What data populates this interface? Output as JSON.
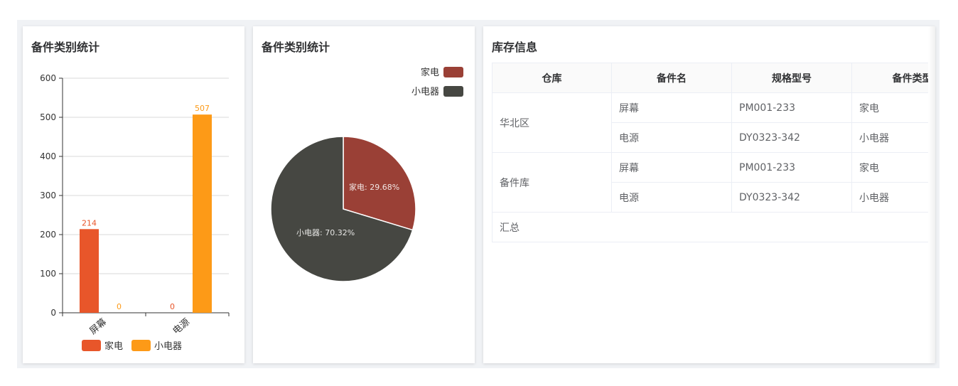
{
  "bar_card": {
    "title": "备件类别统计"
  },
  "pie_card": {
    "title": "备件类别统计"
  },
  "table_card": {
    "title": "库存信息",
    "headers": [
      "仓库",
      "备件名",
      "规格型号",
      "备件类型"
    ],
    "groups": [
      {
        "warehouse": "华北区",
        "rows": [
          {
            "name": "屏幕",
            "model": "PM001-233",
            "type": "家电"
          },
          {
            "name": "电源",
            "model": "DY0323-342",
            "type": "小电器"
          }
        ]
      },
      {
        "warehouse": "备件库",
        "rows": [
          {
            "name": "屏幕",
            "model": "PM001-233",
            "type": "家电"
          },
          {
            "name": "电源",
            "model": "DY0323-342",
            "type": "小电器"
          }
        ]
      }
    ],
    "summary_label": "汇总"
  },
  "colors": {
    "bar_jiadian": "#e8562a",
    "bar_xiaodianqi": "#fd9a17",
    "pie_jiadian": "#9a4036",
    "pie_xiaodianqi": "#464742"
  },
  "chart_data": [
    {
      "type": "bar",
      "title": "备件类别统计",
      "categories": [
        "屏幕",
        "电源"
      ],
      "series": [
        {
          "name": "家电",
          "values": [
            214,
            0
          ]
        },
        {
          "name": "小电器",
          "values": [
            0,
            507
          ]
        }
      ],
      "ylim": [
        0,
        600
      ],
      "yticks": [
        0,
        100,
        200,
        300,
        400,
        500,
        600
      ],
      "grid": true,
      "legend": "bottom"
    },
    {
      "type": "pie",
      "title": "备件类别统计",
      "labels": [
        "家电",
        "小电器"
      ],
      "values": [
        29.68,
        70.32
      ],
      "slice_labels": [
        "家电: 29.68%",
        "小电器: 70.32%"
      ],
      "legend": "top-right"
    }
  ]
}
